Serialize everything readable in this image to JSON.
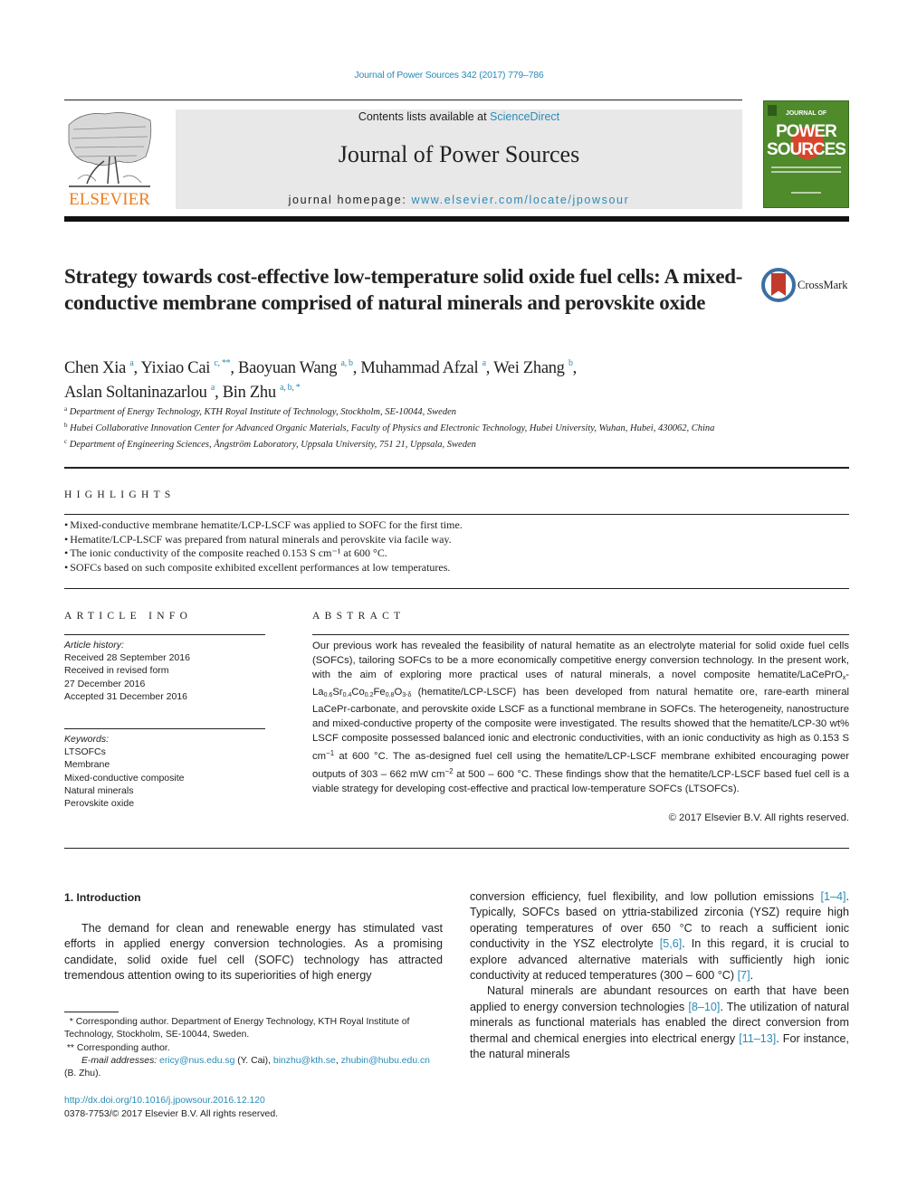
{
  "running_head": "Journal of Power Sources 342 (2017) 779–786",
  "header": {
    "publisher_name": "ELSEVIER",
    "contents_prefix": "Contents lists available at ",
    "contents_link": "ScienceDirect",
    "journal_title": "Journal of Power Sources",
    "homepage_prefix": "journal homepage: ",
    "homepage_link": "www.elsevier.com/locate/jpowsour",
    "cover": {
      "line1": "JOURNAL OF",
      "line2": "POWER",
      "line3": "SOURCES"
    }
  },
  "crossmark_label": "CrossMark",
  "title": "Strategy towards cost-effective low-temperature solid oxide fuel cells: A mixed-conductive membrane comprised of natural minerals and perovskite oxide",
  "authors": [
    {
      "name": "Chen Xia",
      "sup": "a",
      "sep": ", "
    },
    {
      "name": "Yixiao Cai",
      "sup": "c, **",
      "sep": ", "
    },
    {
      "name": "Baoyuan Wang",
      "sup": "a, b",
      "sep": ", "
    },
    {
      "name": "Muhammad Afzal",
      "sup": "a",
      "sep": ", "
    },
    {
      "name": "Wei Zhang",
      "sup": "b",
      "sep": ","
    },
    {
      "name": "Aslan Soltaninazarlou",
      "sup": "a",
      "sep": ", "
    },
    {
      "name": "Bin Zhu",
      "sup": "a, b, *",
      "sep": ""
    }
  ],
  "affiliations": [
    {
      "key": "a",
      "text": "Department of Energy Technology, KTH Royal Institute of Technology, Stockholm, SE-10044, Sweden"
    },
    {
      "key": "b",
      "text": "Hubei Collaborative Innovation Center for Advanced Organic Materials, Faculty of Physics and Electronic Technology, Hubei University, Wuhan, Hubei, 430062, China"
    },
    {
      "key": "c",
      "text": "Department of Engineering Sciences, Ångström Laboratory, Uppsala University, 751 21, Uppsala, Sweden"
    }
  ],
  "highlights": {
    "heading": "HIGHLIGHTS",
    "items": [
      "Mixed-conductive membrane hematite/LCP-LSCF was applied to SOFC for the first time.",
      "Hematite/LCP-LSCF was prepared from natural minerals and perovskite via facile way.",
      "The ionic conductivity of the composite reached 0.153 S cm⁻¹ at 600 °C.",
      "SOFCs based on such composite exhibited excellent performances at low temperatures."
    ]
  },
  "article_info": {
    "heading": "ARTICLE INFO",
    "history_label": "Article history:",
    "history": [
      "Received 28 September 2016",
      "Received in revised form",
      "27 December 2016",
      "Accepted 31 December 2016"
    ],
    "keywords_label": "Keywords:",
    "keywords": [
      "LTSOFCs",
      "Membrane",
      "Mixed-conductive composite",
      "Natural minerals",
      "Perovskite oxide"
    ]
  },
  "abstract": {
    "heading": "ABSTRACT",
    "p1": "Our previous work has revealed the feasibility of natural hematite as an electrolyte material for solid oxide fuel cells (SOFCs), tailoring SOFCs to be a more economically competitive energy conversion technology. In the present work, with the aim of exploring more practical uses of natural minerals, a novel composite hematite/LaCePrO",
    "formula": {
      "x": "x",
      "la": "-La",
      "la_sub": "0.6",
      "sr": "Sr",
      "sr_sub": "0.4",
      "co": "Co",
      "co_sub": "0.2",
      "fe": "Fe",
      "fe_sub": "0.8",
      "o": "O",
      "o_sub": "3-δ"
    },
    "p2": " (hematite/LCP-LSCF) has been developed from natural hematite ore, rare-earth mineral LaCePr-carbonate, and perovskite oxide LSCF as a func­tional membrane in SOFCs. The heterogeneity, nanostructure and mixed-conductive property of the composite were investigated. The results showed that the hematite/LCP-30 wt% LSCF composite possessed balanced ionic and electronic conductivities, with an ionic conductivity as high as 0.153 S cm",
    "sup1": "−1",
    "p3": " at 600 °C. The as-designed fuel cell using the hematite/LCP-LSCF membrane exhibited encouraging power outputs of 303 – 662 mW cm",
    "sup2": "−2",
    "p4": " at 500 – 600 °C. These findings show that the hematite/LCP-LSCF based fuel cell is a viable strategy for developing cost-effective and practical low-temperature SOFCs (LTSOFCs).",
    "copyright": "© 2017 Elsevier B.V. All rights reserved."
  },
  "introduction": {
    "heading": "1.  Introduction",
    "left_p1": "The demand for clean and renewable energy has stimulated vast efforts in applied energy conversion technologies. As a promising candidate, solid oxide fuel cell (SOFC) technology has attracted tremendous attention owing to its superiorities of high energy",
    "right_p1_a": "conversion efficiency, fuel flexibility, and low pollution emissions ",
    "ref1": "[1–4]",
    "right_p1_b": ". Typically, SOFCs based on yttria-stabilized zirconia (YSZ) require high operating temperatures of over 650 °C to reach a sufficient ionic conductivity in the YSZ electrolyte ",
    "ref2": "[5,6]",
    "right_p1_c": ". In this re­gard, it is crucial to explore advanced alternative materials with sufficiently high ionic conductivity at reduced temperatures (300 – 600 °C) ",
    "ref3": "[7]",
    "right_p1_d": ".",
    "right_p2_a": "Natural minerals are abundant resources on earth that have been applied to energy conversion technologies ",
    "ref4": "[8–10]",
    "right_p2_b": ". The utili­zation of natural minerals as functional materials has enabled the direct conversion from thermal and chemical energies into elec­trical energy ",
    "ref5": "[11–13]",
    "right_p2_c": ". For instance, the natural minerals"
  },
  "footnotes": {
    "fn1_mark": "*",
    "fn1": " Corresponding author. Department of Energy Technology, KTH Royal Institute of Technology, Stockholm, SE-10044, Sweden.",
    "fn2_mark": "**",
    "fn2": " Corresponding author.",
    "email_label": "E-mail addresses: ",
    "email1": "ericy@nus.edu.sg",
    "email1_owner": " (Y. Cai), ",
    "email2": "binzhu@kth.se",
    "email_sep": ", ",
    "email3": "zhubin@hubu.edu.cn",
    "email3_owner": " (B. Zhu)."
  },
  "doi": "http://dx.doi.org/10.1016/j.jpowsour.2016.12.120",
  "issn_line": "0378-7753/© 2017 Elsevier B.V. All rights reserved.",
  "colors": {
    "link": "#2a8bb8",
    "elsevier_orange": "#f07c1c",
    "cover_green": "#4f8a2b",
    "header_gray": "#e8e8e8"
  }
}
